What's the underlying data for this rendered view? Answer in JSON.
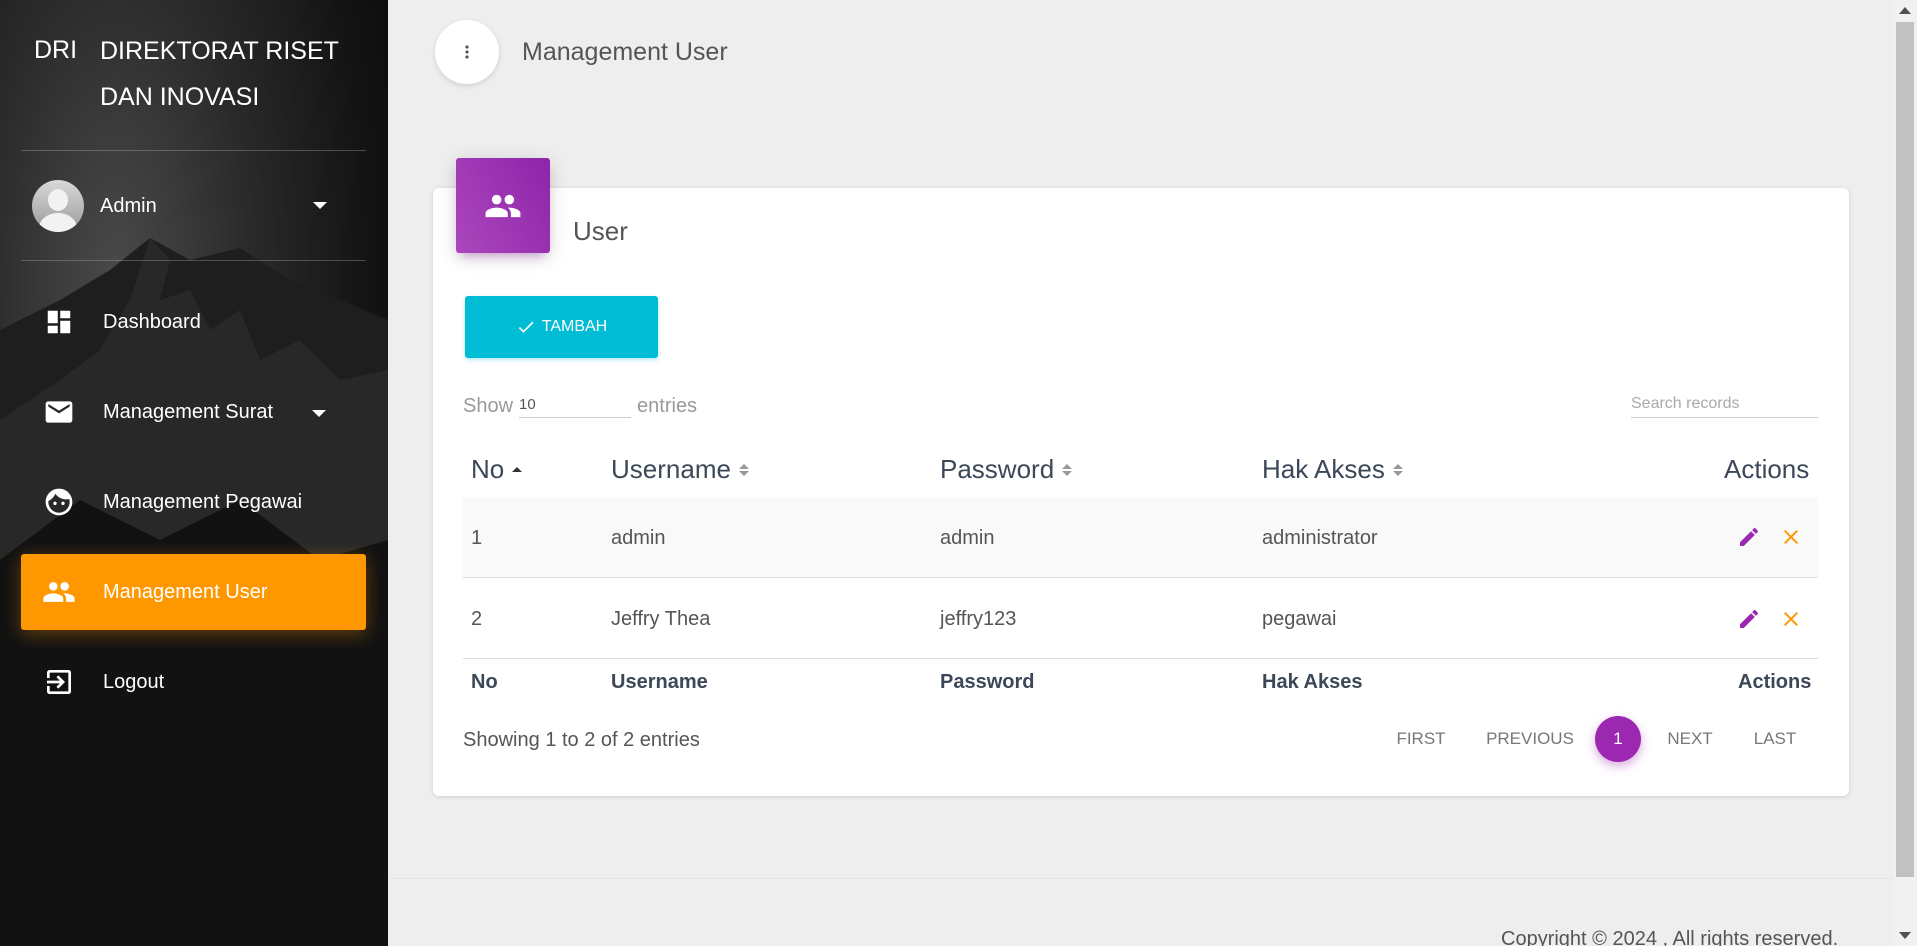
{
  "brand": {
    "mini": "DRI",
    "full_line1": "DIREKTORAT RISET",
    "full_line2": "DAN INOVASI"
  },
  "user": {
    "name": "Admin"
  },
  "sidebar": {
    "items": [
      {
        "label": "Dashboard",
        "icon": "dashboard-icon"
      },
      {
        "label": "Management Surat",
        "icon": "mail-icon"
      },
      {
        "label": "Management Pegawai",
        "icon": "face-icon"
      },
      {
        "label": "Management User",
        "icon": "people-icon",
        "active": true
      },
      {
        "label": "Logout",
        "icon": "logout-icon"
      }
    ]
  },
  "header": {
    "title": "Management User"
  },
  "card": {
    "title": "User",
    "icon": "people-icon"
  },
  "toolbar": {
    "add_label": "TAMBAH"
  },
  "table_controls": {
    "show_label": "Show",
    "length_value": "10",
    "entries_label": "entries",
    "search_placeholder": "Search records"
  },
  "table": {
    "columns": [
      "No",
      "Username",
      "Password",
      "Hak Akses",
      "Actions"
    ],
    "rows": [
      {
        "no": "1",
        "username": "admin",
        "password": "admin",
        "hak_akses": "administrator"
      },
      {
        "no": "2",
        "username": "Jeffry Thea",
        "password": "jeffry123",
        "hak_akses": "pegawai"
      }
    ],
    "footer": [
      "No",
      "Username",
      "Password",
      "Hak Akses",
      "Actions"
    ]
  },
  "pagination": {
    "info": "Showing 1 to 2 of 2 entries",
    "first": "FIRST",
    "previous": "PREVIOUS",
    "current": "1",
    "next": "NEXT",
    "last": "LAST"
  },
  "footer": {
    "copyright": "Copyright © 2024 , All rights reserved."
  },
  "colors": {
    "active_nav": "#ff9800",
    "card_icon": "#9c27b0",
    "add_button": "#00bcd4",
    "edit_icon": "#9c27b0",
    "delete_icon": "#ff9800"
  }
}
